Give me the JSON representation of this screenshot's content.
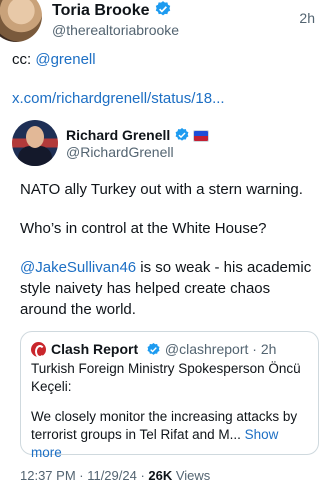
{
  "author": {
    "name": "Toria Brooke",
    "handle": "@therealtoriabrooke",
    "time": "2h"
  },
  "post": {
    "cc_prefix": "cc: ",
    "cc_mention": "@grenell",
    "url": "x.com/richardgrenell/status/18..."
  },
  "embedded": {
    "name": "Richard Grenell",
    "handle": "@RichardGrenell",
    "line1": "NATO ally Turkey out with a stern warning.",
    "line2": "Who’s in control at the White House?",
    "mention": "@JakeSullivan46",
    "line3_rest": " is so weak - his academic style naivety has helped create chaos around the world.",
    "quote": {
      "name": "Clash Report",
      "handle_time": "@clashreport · 2h",
      "text1": "Turkish Foreign Ministry Spokesperson Öncü Keçeli:",
      "text2": "We closely monitor the increasing attacks by terrorist groups in Tel Rifat and M... ",
      "show_more": "Show more"
    },
    "meta_time": "12:37 PM · 11/29/24 · ",
    "views_count": "26K",
    "views_label": " Views"
  },
  "colors": {
    "verified_blue": "#1d9bf0",
    "link_blue": "#1d6fc4",
    "clash_red": "#c9262c"
  }
}
